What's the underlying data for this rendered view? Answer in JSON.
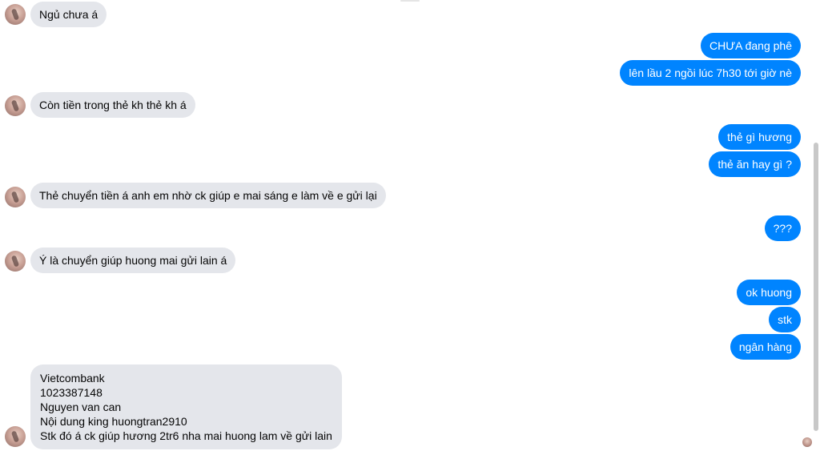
{
  "messages": {
    "in": [
      "Ngủ chưa á",
      "Còn tiền trong thẻ kh thẻ kh á",
      "Thẻ chuyển tiền á anh em nhờ ck giúp e mai sáng e làm về e gửi lại",
      "Ý là chuyển giúp huong mai gửi lain á"
    ],
    "out": [
      "CHƯA đang phê",
      "lên lầu 2 ngồi lúc 7h30 tới giờ nè",
      "thẻ gì hương",
      "thẻ ăn hay gì ?",
      "???",
      "ok huong",
      "stk",
      "ngân hàng"
    ],
    "bank_block": [
      "Vietcombank",
      "1023387148",
      "Nguyen van can",
      "Nội dung king huongtran2910",
      "Stk đó á ck giúp hương 2tr6 nha mai huong lam về gửi lain"
    ]
  },
  "colors": {
    "incoming_bubble": "#e4e6eb",
    "outgoing_bubble": "#0084ff"
  },
  "icons": {
    "avatar": "contact-avatar",
    "seen": "seen-avatar-icon"
  }
}
